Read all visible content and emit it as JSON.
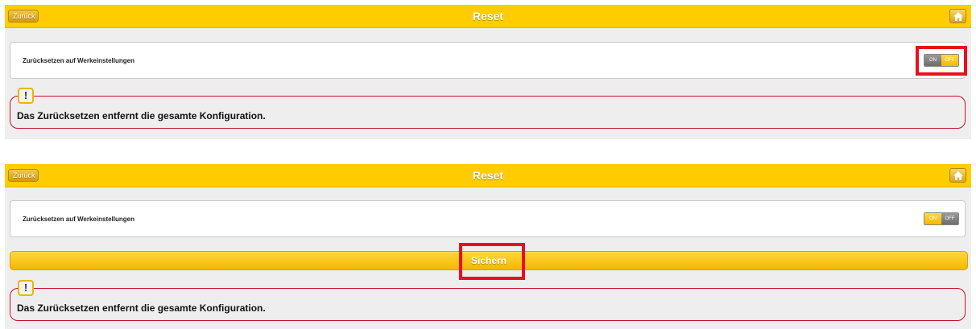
{
  "screens": [
    {
      "header": {
        "back_label": "Zurück",
        "title": "Reset"
      },
      "setting": {
        "label": "Zurücksetzen auf Werkeinstellungen",
        "toggle_on": "ON",
        "toggle_off": "OFF",
        "state": "OFF"
      },
      "notice": {
        "badge": "!",
        "text": "Das Zurücksetzen entfernt die gesamte Konfiguration."
      }
    },
    {
      "header": {
        "back_label": "Zurück",
        "title": "Reset"
      },
      "setting": {
        "label": "Zurücksetzen auf Werkeinstellungen",
        "toggle_on": "ON",
        "toggle_off": "OFF",
        "state": "ON"
      },
      "save_button": {
        "label": "Sichern"
      },
      "notice": {
        "badge": "!",
        "text": "Das Zurücksetzen entfernt die gesamte Konfiguration."
      }
    }
  ],
  "colors": {
    "header": "#ffcc00",
    "highlight": "#e8101f",
    "notice_border": "#c8102e",
    "panel": "#eeeeee"
  },
  "icons": [
    "back-arrow-icon",
    "home-icon",
    "warning-icon"
  ]
}
